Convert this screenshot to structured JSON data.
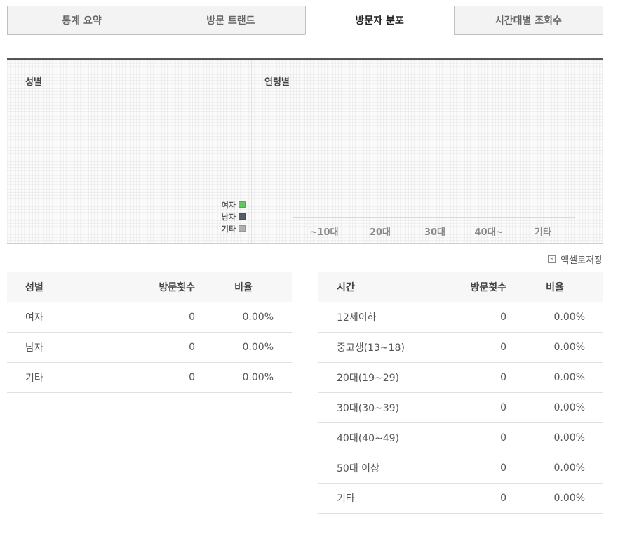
{
  "tabs": [
    {
      "label": "통계 요약",
      "active": false
    },
    {
      "label": "방문 트랜드",
      "active": false
    },
    {
      "label": "방문자 분포",
      "active": true
    },
    {
      "label": "시간대별 조회수",
      "active": false
    }
  ],
  "charts": {
    "gender_title": "성별",
    "age_title": "연령별",
    "legend": [
      {
        "label": "여자",
        "color": "#5cc95c"
      },
      {
        "label": "남자",
        "color": "#555c6e"
      },
      {
        "label": "기타",
        "color": "#b0b0b0"
      }
    ],
    "age_categories": [
      "~10대",
      "20대",
      "30대",
      "40대~",
      "기타"
    ]
  },
  "excel_button": {
    "label": "엑셀로저장",
    "icon": "excel-icon"
  },
  "gender_table": {
    "headers": {
      "label": "성별",
      "count": "방문횟수",
      "ratio": "비율"
    },
    "rows": [
      {
        "label": "여자",
        "count": "0",
        "ratio": "0.00%"
      },
      {
        "label": "남자",
        "count": "0",
        "ratio": "0.00%"
      },
      {
        "label": "기타",
        "count": "0",
        "ratio": "0.00%"
      }
    ]
  },
  "age_table": {
    "headers": {
      "label": "시간",
      "count": "방문횟수",
      "ratio": "비율"
    },
    "rows": [
      {
        "label": "12세이하",
        "count": "0",
        "ratio": "0.00%"
      },
      {
        "label": "중고생(13~18)",
        "count": "0",
        "ratio": "0.00%"
      },
      {
        "label": "20대(19~29)",
        "count": "0",
        "ratio": "0.00%"
      },
      {
        "label": "30대(30~39)",
        "count": "0",
        "ratio": "0.00%"
      },
      {
        "label": "40대(40~49)",
        "count": "0",
        "ratio": "0.00%"
      },
      {
        "label": "50대 이상",
        "count": "0",
        "ratio": "0.00%"
      },
      {
        "label": "기타",
        "count": "0",
        "ratio": "0.00%"
      }
    ]
  }
}
